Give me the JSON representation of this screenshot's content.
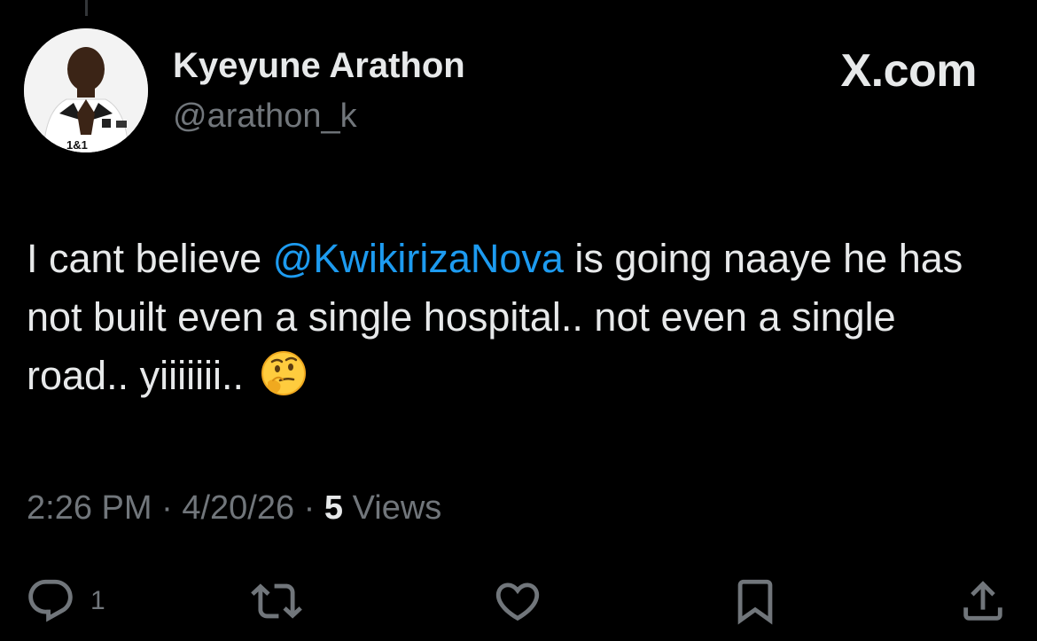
{
  "author": {
    "display_name": "Kyeyune Arathon",
    "handle": "@arathon_k",
    "avatar_jersey_text": "1&1"
  },
  "brand": "X.com",
  "tweet": {
    "text_before_mention": "I cant believe ",
    "mention": "@KwikirizaNova",
    "text_after_mention": " is going naaye he has not built even a single hospital.. not even a single road.. yiiiiiii.. ",
    "emoji_name": "thinking-face-emoji"
  },
  "meta": {
    "time": "2:26 PM",
    "separator": "·",
    "date": "4/20/26",
    "views_count": "5",
    "views_label": "Views"
  },
  "actions": {
    "reply_count": "1",
    "retweet_count": "",
    "like_count": ""
  },
  "colors": {
    "background": "#000000",
    "text_primary": "#e7e9ea",
    "text_secondary": "#71767b",
    "accent": "#1d9bf0"
  }
}
